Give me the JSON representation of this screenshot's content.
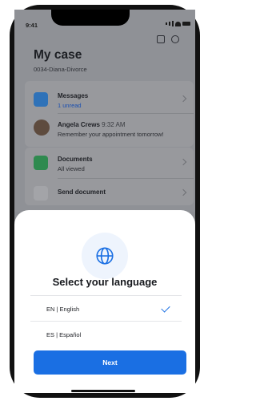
{
  "status_bar": {
    "time": "9:41"
  },
  "header": {
    "title": "My case",
    "case_id": "0034-Diana-Divorce"
  },
  "list": {
    "messages": {
      "label": "Messages",
      "sub": "1 unread"
    },
    "contact": {
      "name": "Angela Crews",
      "time": "9:32 AM",
      "message": "Remember your appointment tomorrow!"
    },
    "documents": {
      "label": "Documents",
      "sub": "All viewed"
    },
    "send": {
      "label": "Send document"
    }
  },
  "language_sheet": {
    "title": "Select your language",
    "options": [
      {
        "label": "EN | English",
        "selected": true
      },
      {
        "label": "ES | Español",
        "selected": false
      }
    ],
    "next_label": "Next"
  },
  "colors": {
    "accent": "#1a6fe3",
    "messages_icon": "#2f72b8",
    "documents_icon": "#2f8a4f",
    "dim": "#8f9196"
  },
  "icons": [
    "briefcase-icon",
    "gear-icon",
    "chat-icon",
    "document-icon",
    "upload-icon",
    "globe-icon",
    "check-icon",
    "chevron-right-icon"
  ]
}
